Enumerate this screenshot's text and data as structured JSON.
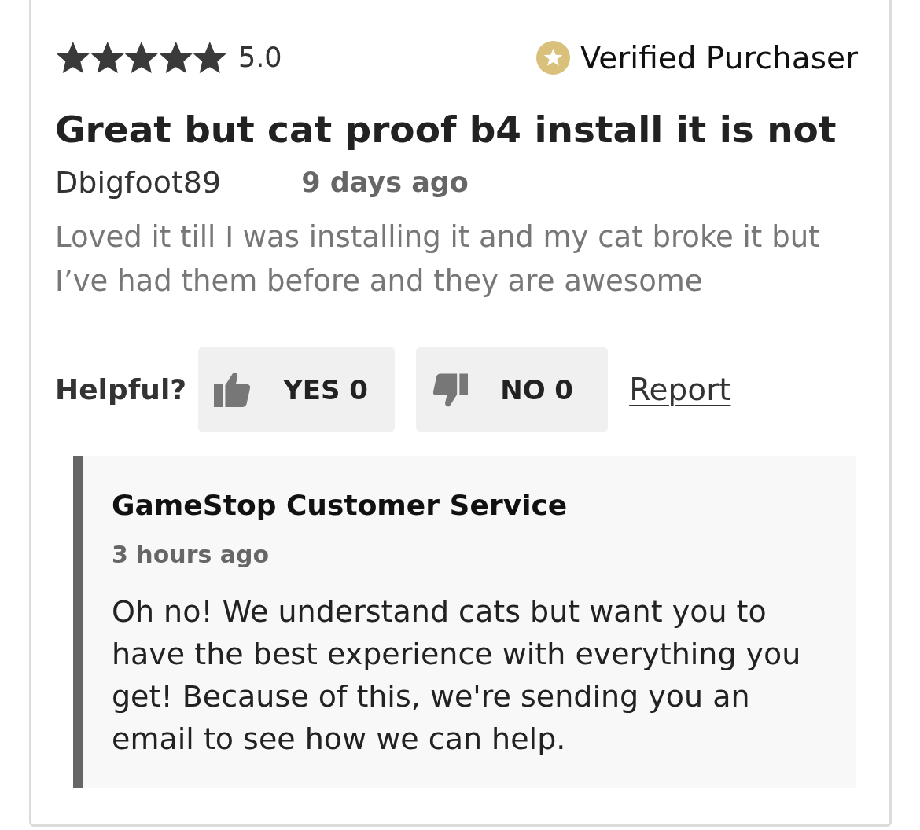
{
  "review": {
    "stars": 5,
    "rating": "5.0",
    "badge": {
      "label": "Verified Purchaser"
    },
    "title": "Great but cat proof b4 install it is not",
    "author": "Dbigfoot89",
    "date": "9 days ago",
    "body": "Loved it till I was installing it and my cat broke it but I’ve had them before and they are awesome",
    "helpful": {
      "label": "Helpful?",
      "buttons": [
        {
          "kind": "yes",
          "label": "YES 0"
        },
        {
          "kind": "no",
          "label": "NO 0"
        }
      ],
      "report": "Report"
    },
    "response": {
      "author": "GameStop Customer Service",
      "date": "3 hours ago",
      "body": "Oh no! We understand cats but want you to have the best experience with everything you get! Because of this, we're sending you an email to see how we can help."
    }
  }
}
